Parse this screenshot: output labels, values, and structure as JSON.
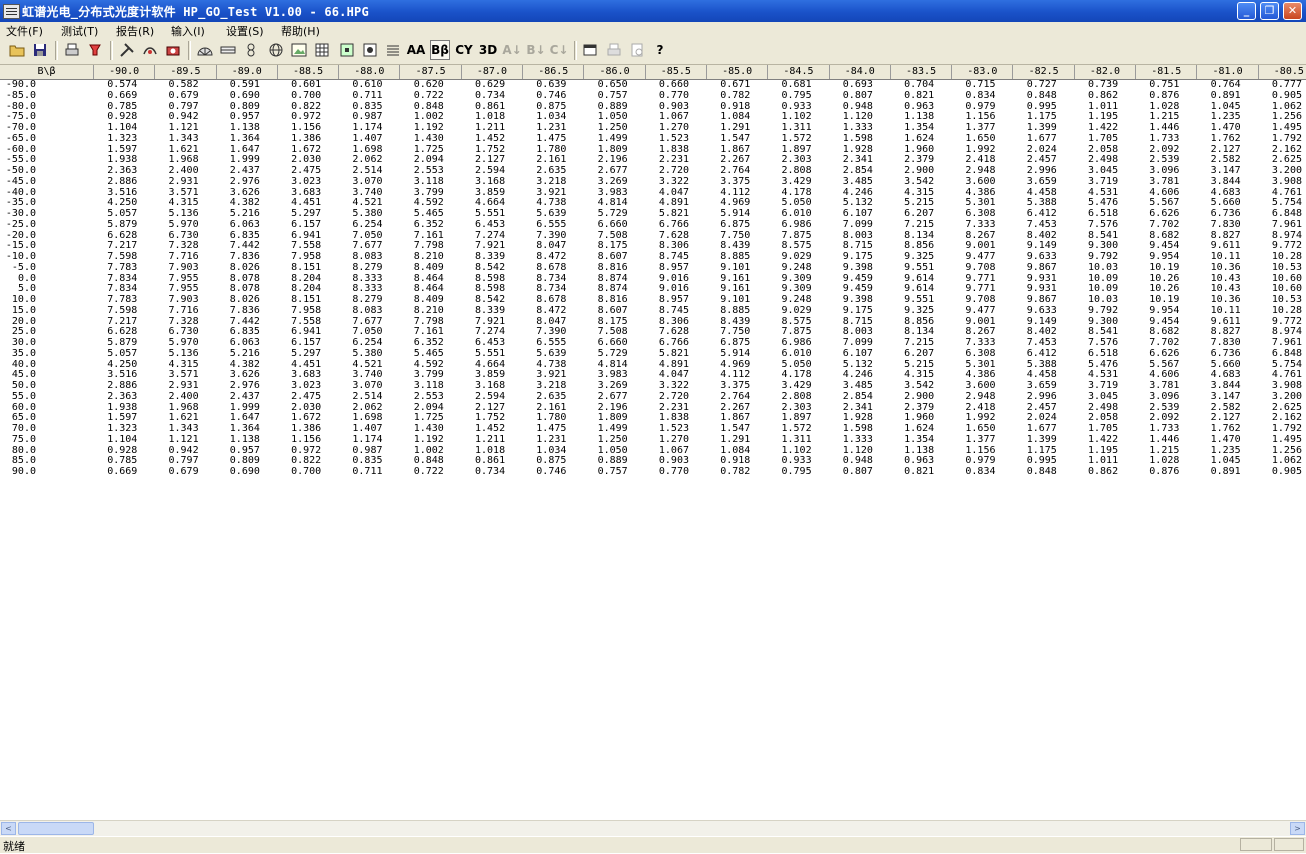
{
  "window": {
    "title": "虹谱光电_分布式光度计软件 HP_GO_Test V1.00 - 66.HPG",
    "minimize_glyph": "_",
    "maximize_glyph": "❐",
    "close_glyph": "✕"
  },
  "menu": [
    "文件(F)",
    "测试(T)",
    "报告(R)",
    "输入(I)",
    "设置(S)",
    "帮助(H)"
  ],
  "toolbar": {
    "text_buttons": {
      "aa": "AA",
      "bb": "Bβ",
      "cy": "CY",
      "d3": "3D",
      "a_sort": "A↓",
      "b_sort": "B↓",
      "c_sort": "C↓"
    },
    "icon_glyphs": {
      "open": "📂",
      "save": "💾",
      "help": "?"
    }
  },
  "grid": {
    "corner": "B\\β",
    "columns": [
      "-90.0",
      "-89.5",
      "-89.0",
      "-88.5",
      "-88.0",
      "-87.5",
      "-87.0",
      "-86.5",
      "-86.0",
      "-85.5",
      "-85.0",
      "-84.5",
      "-84.0",
      "-83.5",
      "-83.0",
      "-82.5",
      "-82.0",
      "-81.5",
      "-81.0",
      "-80.5"
    ],
    "rows": [
      {
        "b": "-90.0",
        "v": [
          "0.574",
          "0.582",
          "0.591",
          "0.601",
          "0.610",
          "0.620",
          "0.629",
          "0.639",
          "0.650",
          "0.660",
          "0.671",
          "0.681",
          "0.693",
          "0.704",
          "0.715",
          "0.727",
          "0.739",
          "0.751",
          "0.764",
          "0.777"
        ]
      },
      {
        "b": "-85.0",
        "v": [
          "0.669",
          "0.679",
          "0.690",
          "0.700",
          "0.711",
          "0.722",
          "0.734",
          "0.746",
          "0.757",
          "0.770",
          "0.782",
          "0.795",
          "0.807",
          "0.821",
          "0.834",
          "0.848",
          "0.862",
          "0.876",
          "0.891",
          "0.905"
        ]
      },
      {
        "b": "-80.0",
        "v": [
          "0.785",
          "0.797",
          "0.809",
          "0.822",
          "0.835",
          "0.848",
          "0.861",
          "0.875",
          "0.889",
          "0.903",
          "0.918",
          "0.933",
          "0.948",
          "0.963",
          "0.979",
          "0.995",
          "1.011",
          "1.028",
          "1.045",
          "1.062"
        ]
      },
      {
        "b": "-75.0",
        "v": [
          "0.928",
          "0.942",
          "0.957",
          "0.972",
          "0.987",
          "1.002",
          "1.018",
          "1.034",
          "1.050",
          "1.067",
          "1.084",
          "1.102",
          "1.120",
          "1.138",
          "1.156",
          "1.175",
          "1.195",
          "1.215",
          "1.235",
          "1.256"
        ]
      },
      {
        "b": "-70.0",
        "v": [
          "1.104",
          "1.121",
          "1.138",
          "1.156",
          "1.174",
          "1.192",
          "1.211",
          "1.231",
          "1.250",
          "1.270",
          "1.291",
          "1.311",
          "1.333",
          "1.354",
          "1.377",
          "1.399",
          "1.422",
          "1.446",
          "1.470",
          "1.495"
        ]
      },
      {
        "b": "-65.0",
        "v": [
          "1.323",
          "1.343",
          "1.364",
          "1.386",
          "1.407",
          "1.430",
          "1.452",
          "1.475",
          "1.499",
          "1.523",
          "1.547",
          "1.572",
          "1.598",
          "1.624",
          "1.650",
          "1.677",
          "1.705",
          "1.733",
          "1.762",
          "1.792"
        ]
      },
      {
        "b": "-60.0",
        "v": [
          "1.597",
          "1.621",
          "1.647",
          "1.672",
          "1.698",
          "1.725",
          "1.752",
          "1.780",
          "1.809",
          "1.838",
          "1.867",
          "1.897",
          "1.928",
          "1.960",
          "1.992",
          "2.024",
          "2.058",
          "2.092",
          "2.127",
          "2.162"
        ]
      },
      {
        "b": "-55.0",
        "v": [
          "1.938",
          "1.968",
          "1.999",
          "2.030",
          "2.062",
          "2.094",
          "2.127",
          "2.161",
          "2.196",
          "2.231",
          "2.267",
          "2.303",
          "2.341",
          "2.379",
          "2.418",
          "2.457",
          "2.498",
          "2.539",
          "2.582",
          "2.625"
        ]
      },
      {
        "b": "-50.0",
        "v": [
          "2.363",
          "2.400",
          "2.437",
          "2.475",
          "2.514",
          "2.553",
          "2.594",
          "2.635",
          "2.677",
          "2.720",
          "2.764",
          "2.808",
          "2.854",
          "2.900",
          "2.948",
          "2.996",
          "3.045",
          "3.096",
          "3.147",
          "3.200"
        ]
      },
      {
        "b": "-45.0",
        "v": [
          "2.886",
          "2.931",
          "2.976",
          "3.023",
          "3.070",
          "3.118",
          "3.168",
          "3.218",
          "3.269",
          "3.322",
          "3.375",
          "3.429",
          "3.485",
          "3.542",
          "3.600",
          "3.659",
          "3.719",
          "3.781",
          "3.844",
          "3.908"
        ]
      },
      {
        "b": "-40.0",
        "v": [
          "3.516",
          "3.571",
          "3.626",
          "3.683",
          "3.740",
          "3.799",
          "3.859",
          "3.921",
          "3.983",
          "4.047",
          "4.112",
          "4.178",
          "4.246",
          "4.315",
          "4.386",
          "4.458",
          "4.531",
          "4.606",
          "4.683",
          "4.761"
        ]
      },
      {
        "b": "-35.0",
        "v": [
          "4.250",
          "4.315",
          "4.382",
          "4.451",
          "4.521",
          "4.592",
          "4.664",
          "4.738",
          "4.814",
          "4.891",
          "4.969",
          "5.050",
          "5.132",
          "5.215",
          "5.301",
          "5.388",
          "5.476",
          "5.567",
          "5.660",
          "5.754"
        ]
      },
      {
        "b": "-30.0",
        "v": [
          "5.057",
          "5.136",
          "5.216",
          "5.297",
          "5.380",
          "5.465",
          "5.551",
          "5.639",
          "5.729",
          "5.821",
          "5.914",
          "6.010",
          "6.107",
          "6.207",
          "6.308",
          "6.412",
          "6.518",
          "6.626",
          "6.736",
          "6.848"
        ]
      },
      {
        "b": "-25.0",
        "v": [
          "5.879",
          "5.970",
          "6.063",
          "6.157",
          "6.254",
          "6.352",
          "6.453",
          "6.555",
          "6.660",
          "6.766",
          "6.875",
          "6.986",
          "7.099",
          "7.215",
          "7.333",
          "7.453",
          "7.576",
          "7.702",
          "7.830",
          "7.961"
        ]
      },
      {
        "b": "-20.0",
        "v": [
          "6.628",
          "6.730",
          "6.835",
          "6.941",
          "7.050",
          "7.161",
          "7.274",
          "7.390",
          "7.508",
          "7.628",
          "7.750",
          "7.875",
          "8.003",
          "8.134",
          "8.267",
          "8.402",
          "8.541",
          "8.682",
          "8.827",
          "8.974"
        ]
      },
      {
        "b": "-15.0",
        "v": [
          "7.217",
          "7.328",
          "7.442",
          "7.558",
          "7.677",
          "7.798",
          "7.921",
          "8.047",
          "8.175",
          "8.306",
          "8.439",
          "8.575",
          "8.715",
          "8.856",
          "9.001",
          "9.149",
          "9.300",
          "9.454",
          "9.611",
          "9.772"
        ]
      },
      {
        "b": "-10.0",
        "v": [
          "7.598",
          "7.716",
          "7.836",
          "7.958",
          "8.083",
          "8.210",
          "8.339",
          "8.472",
          "8.607",
          "8.745",
          "8.885",
          "9.029",
          "9.175",
          "9.325",
          "9.477",
          "9.633",
          "9.792",
          "9.954",
          "10.11",
          "10.28"
        ]
      },
      {
        "b": "-5.0",
        "v": [
          "7.783",
          "7.903",
          "8.026",
          "8.151",
          "8.279",
          "8.409",
          "8.542",
          "8.678",
          "8.816",
          "8.957",
          "9.101",
          "9.248",
          "9.398",
          "9.551",
          "9.708",
          "9.867",
          "10.03",
          "10.19",
          "10.36",
          "10.53"
        ]
      },
      {
        "b": "0.0",
        "v": [
          "7.834",
          "7.955",
          "8.078",
          "8.204",
          "8.333",
          "8.464",
          "8.598",
          "8.734",
          "8.874",
          "9.016",
          "9.161",
          "9.309",
          "9.459",
          "9.614",
          "9.771",
          "9.931",
          "10.09",
          "10.26",
          "10.43",
          "10.60"
        ]
      },
      {
        "b": "5.0",
        "v": [
          "7.834",
          "7.955",
          "8.078",
          "8.204",
          "8.333",
          "8.464",
          "8.598",
          "8.734",
          "8.874",
          "9.016",
          "9.161",
          "9.309",
          "9.459",
          "9.614",
          "9.771",
          "9.931",
          "10.09",
          "10.26",
          "10.43",
          "10.60"
        ]
      },
      {
        "b": "10.0",
        "v": [
          "7.783",
          "7.903",
          "8.026",
          "8.151",
          "8.279",
          "8.409",
          "8.542",
          "8.678",
          "8.816",
          "8.957",
          "9.101",
          "9.248",
          "9.398",
          "9.551",
          "9.708",
          "9.867",
          "10.03",
          "10.19",
          "10.36",
          "10.53"
        ]
      },
      {
        "b": "15.0",
        "v": [
          "7.598",
          "7.716",
          "7.836",
          "7.958",
          "8.083",
          "8.210",
          "8.339",
          "8.472",
          "8.607",
          "8.745",
          "8.885",
          "9.029",
          "9.175",
          "9.325",
          "9.477",
          "9.633",
          "9.792",
          "9.954",
          "10.11",
          "10.28"
        ]
      },
      {
        "b": "20.0",
        "v": [
          "7.217",
          "7.328",
          "7.442",
          "7.558",
          "7.677",
          "7.798",
          "7.921",
          "8.047",
          "8.175",
          "8.306",
          "8.439",
          "8.575",
          "8.715",
          "8.856",
          "9.001",
          "9.149",
          "9.300",
          "9.454",
          "9.611",
          "9.772"
        ]
      },
      {
        "b": "25.0",
        "v": [
          "6.628",
          "6.730",
          "6.835",
          "6.941",
          "7.050",
          "7.161",
          "7.274",
          "7.390",
          "7.508",
          "7.628",
          "7.750",
          "7.875",
          "8.003",
          "8.134",
          "8.267",
          "8.402",
          "8.541",
          "8.682",
          "8.827",
          "8.974"
        ]
      },
      {
        "b": "30.0",
        "v": [
          "5.879",
          "5.970",
          "6.063",
          "6.157",
          "6.254",
          "6.352",
          "6.453",
          "6.555",
          "6.660",
          "6.766",
          "6.875",
          "6.986",
          "7.099",
          "7.215",
          "7.333",
          "7.453",
          "7.576",
          "7.702",
          "7.830",
          "7.961"
        ]
      },
      {
        "b": "35.0",
        "v": [
          "5.057",
          "5.136",
          "5.216",
          "5.297",
          "5.380",
          "5.465",
          "5.551",
          "5.639",
          "5.729",
          "5.821",
          "5.914",
          "6.010",
          "6.107",
          "6.207",
          "6.308",
          "6.412",
          "6.518",
          "6.626",
          "6.736",
          "6.848"
        ]
      },
      {
        "b": "40.0",
        "v": [
          "4.250",
          "4.315",
          "4.382",
          "4.451",
          "4.521",
          "4.592",
          "4.664",
          "4.738",
          "4.814",
          "4.891",
          "4.969",
          "5.050",
          "5.132",
          "5.215",
          "5.301",
          "5.388",
          "5.476",
          "5.567",
          "5.660",
          "5.754"
        ]
      },
      {
        "b": "45.0",
        "v": [
          "3.516",
          "3.571",
          "3.626",
          "3.683",
          "3.740",
          "3.799",
          "3.859",
          "3.921",
          "3.983",
          "4.047",
          "4.112",
          "4.178",
          "4.246",
          "4.315",
          "4.386",
          "4.458",
          "4.531",
          "4.606",
          "4.683",
          "4.761"
        ]
      },
      {
        "b": "50.0",
        "v": [
          "2.886",
          "2.931",
          "2.976",
          "3.023",
          "3.070",
          "3.118",
          "3.168",
          "3.218",
          "3.269",
          "3.322",
          "3.375",
          "3.429",
          "3.485",
          "3.542",
          "3.600",
          "3.659",
          "3.719",
          "3.781",
          "3.844",
          "3.908"
        ]
      },
      {
        "b": "55.0",
        "v": [
          "2.363",
          "2.400",
          "2.437",
          "2.475",
          "2.514",
          "2.553",
          "2.594",
          "2.635",
          "2.677",
          "2.720",
          "2.764",
          "2.808",
          "2.854",
          "2.900",
          "2.948",
          "2.996",
          "3.045",
          "3.096",
          "3.147",
          "3.200"
        ]
      },
      {
        "b": "60.0",
        "v": [
          "1.938",
          "1.968",
          "1.999",
          "2.030",
          "2.062",
          "2.094",
          "2.127",
          "2.161",
          "2.196",
          "2.231",
          "2.267",
          "2.303",
          "2.341",
          "2.379",
          "2.418",
          "2.457",
          "2.498",
          "2.539",
          "2.582",
          "2.625"
        ]
      },
      {
        "b": "65.0",
        "v": [
          "1.597",
          "1.621",
          "1.647",
          "1.672",
          "1.698",
          "1.725",
          "1.752",
          "1.780",
          "1.809",
          "1.838",
          "1.867",
          "1.897",
          "1.928",
          "1.960",
          "1.992",
          "2.024",
          "2.058",
          "2.092",
          "2.127",
          "2.162"
        ]
      },
      {
        "b": "70.0",
        "v": [
          "1.323",
          "1.343",
          "1.364",
          "1.386",
          "1.407",
          "1.430",
          "1.452",
          "1.475",
          "1.499",
          "1.523",
          "1.547",
          "1.572",
          "1.598",
          "1.624",
          "1.650",
          "1.677",
          "1.705",
          "1.733",
          "1.762",
          "1.792"
        ]
      },
      {
        "b": "75.0",
        "v": [
          "1.104",
          "1.121",
          "1.138",
          "1.156",
          "1.174",
          "1.192",
          "1.211",
          "1.231",
          "1.250",
          "1.270",
          "1.291",
          "1.311",
          "1.333",
          "1.354",
          "1.377",
          "1.399",
          "1.422",
          "1.446",
          "1.470",
          "1.495"
        ]
      },
      {
        "b": "80.0",
        "v": [
          "0.928",
          "0.942",
          "0.957",
          "0.972",
          "0.987",
          "1.002",
          "1.018",
          "1.034",
          "1.050",
          "1.067",
          "1.084",
          "1.102",
          "1.120",
          "1.138",
          "1.156",
          "1.175",
          "1.195",
          "1.215",
          "1.235",
          "1.256"
        ]
      },
      {
        "b": "85.0",
        "v": [
          "0.785",
          "0.797",
          "0.809",
          "0.822",
          "0.835",
          "0.848",
          "0.861",
          "0.875",
          "0.889",
          "0.903",
          "0.918",
          "0.933",
          "0.948",
          "0.963",
          "0.979",
          "0.995",
          "1.011",
          "1.028",
          "1.045",
          "1.062"
        ]
      },
      {
        "b": "90.0",
        "v": [
          "0.669",
          "0.679",
          "0.690",
          "0.700",
          "0.711",
          "0.722",
          "0.734",
          "0.746",
          "0.757",
          "0.770",
          "0.782",
          "0.795",
          "0.807",
          "0.821",
          "0.834",
          "0.848",
          "0.862",
          "0.876",
          "0.891",
          "0.905"
        ]
      }
    ]
  },
  "scrollbar": {
    "left_arrow": "<",
    "right_arrow": ">"
  },
  "status": {
    "text": "就绪"
  },
  "colors": {
    "titlebar": "#1a52c9",
    "chrome": "#ece9d8",
    "grid_bg": "#ffffff"
  }
}
